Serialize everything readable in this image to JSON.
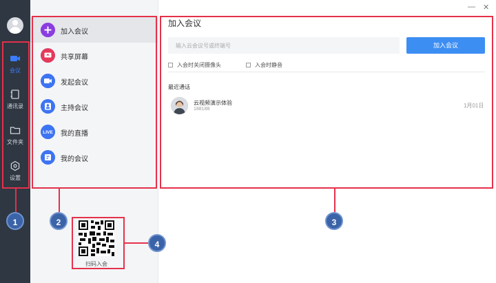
{
  "window": {
    "minimize_glyph": "—",
    "close_glyph": "✕"
  },
  "rail": {
    "items": [
      {
        "label": "会议",
        "icon": "video-camera-icon",
        "active": true
      },
      {
        "label": "通讯录",
        "icon": "contacts-icon",
        "active": false
      },
      {
        "label": "文件夹",
        "icon": "folder-icon",
        "active": false
      },
      {
        "label": "设置",
        "icon": "settings-hexagon-icon",
        "active": false
      }
    ]
  },
  "menu": {
    "items": [
      {
        "label": "加入会议",
        "icon": "plus-icon"
      },
      {
        "label": "共享屏幕",
        "icon": "share-screen-icon"
      },
      {
        "label": "发起会议",
        "icon": "video-start-icon"
      },
      {
        "label": "主持会议",
        "icon": "host-icon"
      },
      {
        "label": "我的直播",
        "icon": "live-icon",
        "badge": "LIVE"
      },
      {
        "label": "我的会议",
        "icon": "my-meetings-icon"
      }
    ],
    "qr_label": "扫码入会"
  },
  "main": {
    "title": "加入会议",
    "input_placeholder": "输入云会议号或终端号",
    "join_button": "加入会议",
    "options": [
      "入会时关闭摄像头",
      "入会时静音"
    ],
    "recent_label": "最近通话",
    "recent_calls": [
      {
        "name": "云视频演示体验",
        "number": "188188",
        "date": "1月01日"
      }
    ]
  },
  "annotations": {
    "colors": {
      "box": "#e5304a",
      "badge": "#3b63a8"
    },
    "badges": [
      "1",
      "2",
      "3",
      "4"
    ]
  },
  "colors": {
    "rail_bg": "#2f3742",
    "accent": "#3d8ef3",
    "active_label": "#3b7cff"
  }
}
